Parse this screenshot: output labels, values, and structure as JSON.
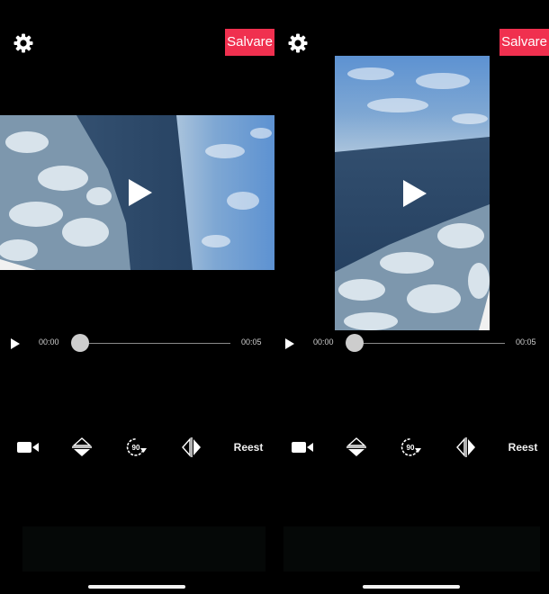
{
  "header": {
    "save_label": "Salvare"
  },
  "icons": {
    "settings": "gear-icon",
    "play": "play-icon",
    "camera": "video-camera-icon",
    "flip_vertical": "flip-vertical-icon",
    "rotate": "rotate-90-icon",
    "flip_horizontal": "flip-horizontal-icon"
  },
  "player": {
    "time_start": "00:00",
    "time_end": "00:05",
    "progress": 0.0
  },
  "toolbar": {
    "rotate_label": "90",
    "reset_label": "Reest"
  },
  "colors": {
    "accent": "#f0304f",
    "background": "#000000",
    "sky": "#6f9fd0",
    "sea": "#2a4563",
    "foam": "#d9e6ee"
  },
  "screens": [
    {
      "id": "before",
      "orientation": "rotated"
    },
    {
      "id": "after",
      "orientation": "upright"
    }
  ]
}
